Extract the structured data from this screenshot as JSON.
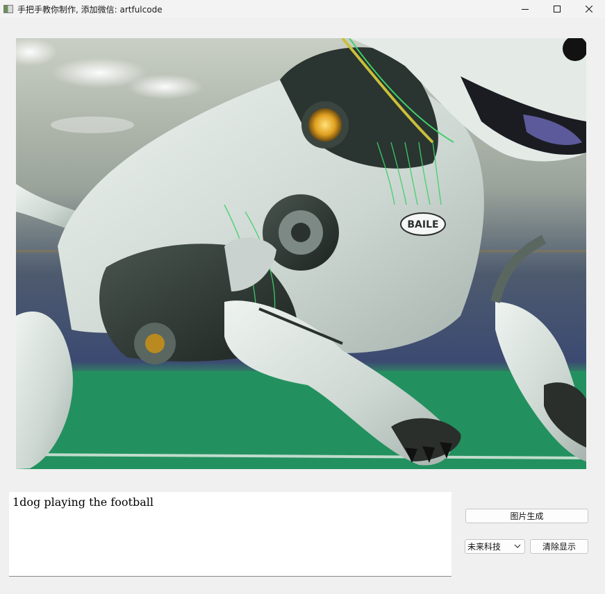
{
  "window": {
    "title": "手把手教你制作, 添加微信: artfulcode",
    "controls": [
      "minimize",
      "maximize",
      "close"
    ]
  },
  "generated_image": {
    "subject": "robot-dog-on-football-field",
    "logo_text": "BAILE"
  },
  "prompt": {
    "value": "1dog playing the football"
  },
  "buttons": {
    "generate_label": "图片生成",
    "clear_label": "清除显示"
  },
  "style_select": {
    "selected": "未来科技"
  },
  "colors": {
    "background": "#f0f0f0",
    "field_green": "#2e9a6a",
    "robot_white": "#dfe6e2",
    "accent_green": "#3fd06a"
  }
}
